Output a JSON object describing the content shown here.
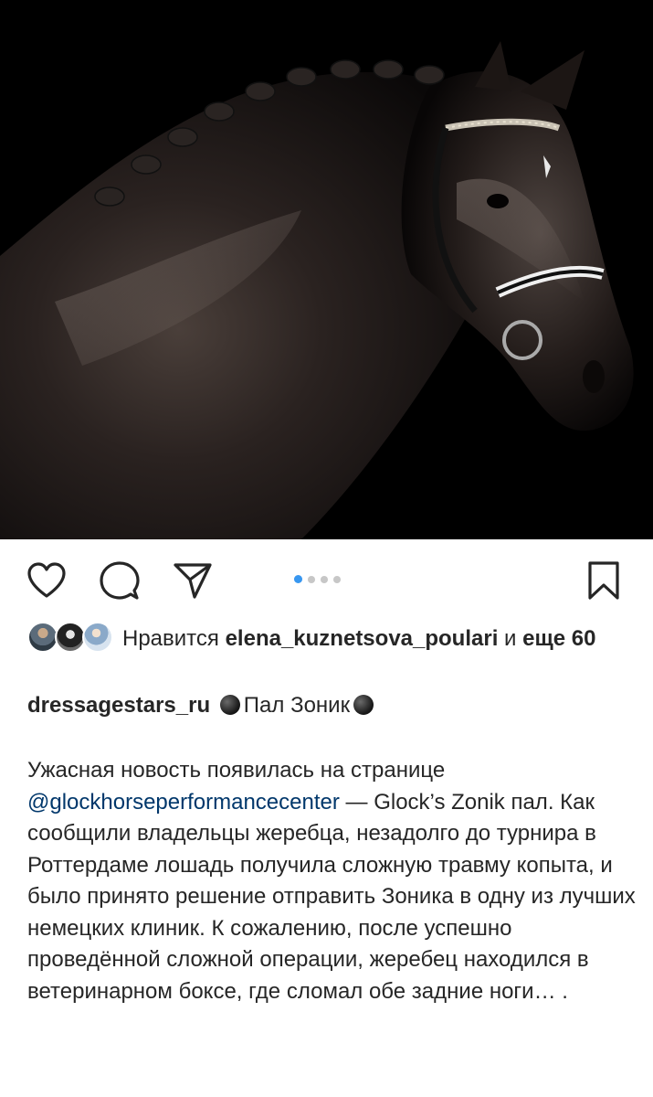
{
  "post": {
    "image_alt": "black stallion portrait with braided mane and bridle",
    "carousel": {
      "count": 4,
      "active_index": 0
    }
  },
  "actions": {
    "like_icon": "heart-icon",
    "comment_icon": "comment-icon",
    "share_icon": "paper-plane-icon",
    "save_icon": "bookmark-icon"
  },
  "likes": {
    "prefix": "Нравится",
    "user": "elena_kuznetsova_poulari",
    "conjunction": "и",
    "more_label": "еще",
    "more_count": "60"
  },
  "caption": {
    "username": "dressagestars_ru",
    "title": "Пал Зоник",
    "line1": "Ужасная новость появилась на странице",
    "mention": "@glockhorseperformancecenter",
    "after_mention": " — Glock’s Zonik пал.",
    "text": "Как сообщили владельцы жеребца, незадолго до турнира в Роттердаме лошадь получила сложную травму копыта, и было принято решение отправить Зоника в одну из лучших немецких клиник. К сожалению, после успешно проведённой сложной операции, жеребец находился в ветеринарном боксе, где сломал обе задние ноги… ."
  },
  "colors": {
    "text": "#262626",
    "mention": "#00376b",
    "carousel_active": "#3897f0",
    "carousel_inactive": "#c7c7c7",
    "photo_background": "#000000"
  }
}
